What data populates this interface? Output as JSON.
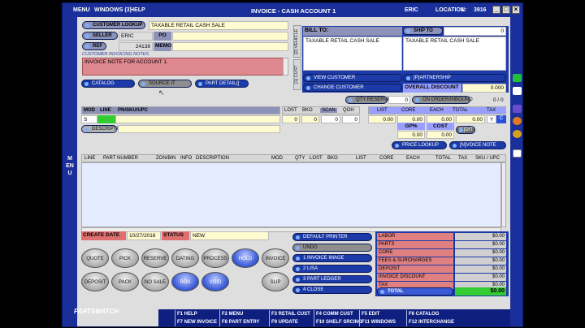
{
  "titlebar": {
    "menu": "MENU",
    "windows": "WINDOWS (3)",
    "help": "HELP",
    "title": "INVOICE - CASH ACCOUNT 1",
    "user": "ERIC",
    "location_label": "LOCATION:",
    "location_num": "1",
    "location_code": "3916"
  },
  "side_menu": "MENU",
  "header": {
    "customer_lookup_label": "CUSTOMER LOOKUP",
    "customer_lookup_value": "TAXABLE RETAIL CASH SALE",
    "seller_label": "SELLER",
    "seller_value": "ERIC",
    "po_label": "PO",
    "po_value": "",
    "ref_label": "REF",
    "ref_value": "24138",
    "memo_label": "MEMO",
    "memo_value": "",
    "notes_label": "CUSTOMER INVOICING NOTES",
    "notes_value": "INVOICE NOTE FOR ACCOUNT 1.",
    "catalog": "CATALOG",
    "source_it": "SOURCE IT",
    "part_detail": "PART DETAIL(]"
  },
  "tabs": {
    "vehicle": "[2] VEHICLE",
    "cust": "[1] CUST"
  },
  "bill_to": {
    "label": "BILL TO:",
    "value": "TAXABLE RETAIL CASH SALE",
    "view_customer": "VIEW CUSTOMER",
    "change_customer": "CHANGE CUSTOMER"
  },
  "ship_to": {
    "label": "SHIP TO",
    "value": "TAXABLE RETAIL CASH SALE",
    "qty": "0",
    "partnership": "[P]ARTNERSHIP",
    "overall_discount_label": "OVERALL DISCOUNT",
    "overall_discount_value": "0.000"
  },
  "qty_reserve": {
    "label": "QTY RESERVE",
    "value": "0",
    "on_order": "ON ORDER/INBOUND",
    "count": "0 / 0"
  },
  "entry": {
    "headers": [
      "MOD",
      "LINE",
      "PN/SKU/UPC",
      "LOST",
      "BKO",
      "SCAN",
      "QOH",
      "LIST",
      "CORE",
      "EACH",
      "TOTAL",
      "TAX"
    ],
    "mod_value": "S",
    "lost": "0",
    "bko": "0",
    "scan": "0",
    "qoh": "0",
    "list": "0.00",
    "core": "0.00",
    "each": "0.00",
    "total": "0.00",
    "tax_y": "Y",
    "tax_c": "C",
    "description_label": "DESCRIPTION",
    "gp_label": "GP%",
    "cost_label": "COST",
    "gp_value": "0.00",
    "cost_value": "0.00",
    "edit": "[E]DIT",
    "price_lookup": "PRICE LOOKUP",
    "invoice_note": "[N]VOICE NOTE"
  },
  "grid": {
    "headers": [
      "LINE",
      "PART NUMBER",
      "ZON/BIN",
      "INFO",
      "DESCRIPTION",
      "MOD",
      "QTY",
      "LOST",
      "BKO",
      "LIST",
      "CORE",
      "EACH",
      "TOTAL",
      "TAX",
      "SKU / UPC"
    ]
  },
  "status": {
    "create_date_label": "CREATE DATE",
    "create_date_value": "10/27/2016",
    "status_label": "STATUS",
    "status_value": "NEW"
  },
  "round_buttons": [
    "QUOTE",
    "PICK",
    "RESERVE",
    "DATING",
    "PROCESS",
    "HOLD",
    "INVOICE",
    "DEPOSIT",
    "PACK",
    "NO SALE",
    "ROA",
    "VOID",
    "SLIP"
  ],
  "actions": [
    "DEFAULT PRINTER",
    "UNDO",
    "1 INVOICE IMAGE",
    "2 LISA",
    "3 PART LEDGER",
    "4 CLOSE"
  ],
  "totals": [
    {
      "label": "LABOR",
      "value": "$0.00"
    },
    {
      "label": "PARTS",
      "value": "$0.00"
    },
    {
      "label": "CORE",
      "value": "$0.00"
    },
    {
      "label": "FEES & SURCHARGES",
      "value": "$0.00"
    },
    {
      "label": "DEPOSIT",
      "value": "$0.00"
    },
    {
      "label": "INVOICE DISCOUNT",
      "value": "$0.00"
    },
    {
      "label": "TAX",
      "value": "$0.00"
    }
  ],
  "total": {
    "label": "TOTAL",
    "value": "$0.00"
  },
  "logo": "PARTSWATCH",
  "fkeys": [
    "F1 HELP",
    "F2 MENU",
    "F3 RETAIL CUST",
    "F4 COMM CUST",
    "F5 EDIT",
    "F6 CATALOG",
    "F7 NEW INVOICE",
    "F8 PART ENTRY",
    "F9 UPDATE",
    "F10 SHELF SRCING",
    "F11 WINDOWS",
    "F12 INTERCHANGE"
  ],
  "colors": {
    "frame": "#1f3fb8",
    "field": "#fffbd0",
    "total_green": "#33cc33",
    "totals_red": "#e08080"
  }
}
